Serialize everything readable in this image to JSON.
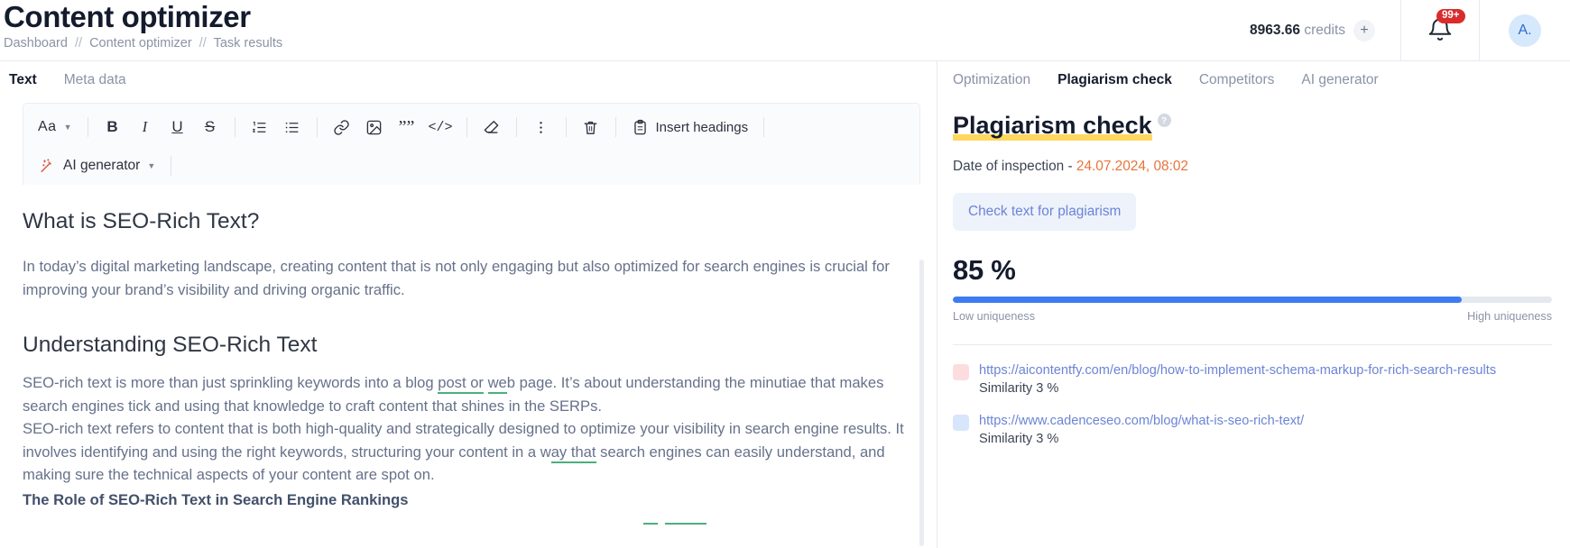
{
  "header": {
    "title": "Content optimizer",
    "breadcrumb": [
      "Dashboard",
      "Content optimizer",
      "Task results"
    ],
    "separator": "//",
    "credits_value": "8963.66",
    "credits_label": "credits",
    "add_credits_icon": "plus-icon",
    "notifications_badge": "99+",
    "avatar_initials": "A."
  },
  "editor": {
    "tabs": [
      {
        "label": "Text",
        "active": true
      },
      {
        "label": "Meta data",
        "active": false
      }
    ],
    "toolbar": {
      "font_size_label": "Aa",
      "bold_label": "B",
      "italic_label": "I",
      "underline_label": "U",
      "strike_label": "S",
      "ordered_list_icon": "ordered-list-icon",
      "bullet_list_icon": "bullet-list-icon",
      "link_icon": "link-icon",
      "image_icon": "image-icon",
      "quote_label": "””",
      "code_label": "</>",
      "eraser_icon": "eraser-icon",
      "more_icon": "more-vertical-icon",
      "trash_icon": "trash-icon",
      "insert_headings_label": "Insert headings",
      "clipboard_icon": "clipboard-icon",
      "ai_generator_label": "AI generator",
      "ai_icon": "magic-wand-icon"
    },
    "content": {
      "h2_first": "What is SEO-Rich Text?",
      "p1": "In today’s digital marketing landscape, creating content that is not only engaging but also optimized for search engines is crucial for improving your brand’s visibility and driving organic traffic.",
      "h2_second": "Understanding SEO-Rich Text",
      "p2_a": "SEO-rich text is more than just sprinkling keywords into a blog ",
      "p2_mark1": "post or",
      "p2_b": " ",
      "p2_mark2": "we",
      "p2_c": "b page. It’s about understanding the minutiae that makes search engines tick and using that knowledge to craft content that shines in the SERPs.",
      "p3_a": "SEO-rich text refers to content that is both high-quality and strategically designed to optimize your visibility in search engine results. It involves identifying and using the right keywords, structuring your content in a w",
      "p3_mark": "ay that",
      "p3_b": " search engines can easily understand, and making sure the technical aspects of your content are spot on.",
      "h3": "The Role of SEO-Rich Text in Search Engine Rankings"
    }
  },
  "right_panel": {
    "tabs": [
      {
        "label": "Optimization",
        "active": false
      },
      {
        "label": "Plagiarism check",
        "active": true
      },
      {
        "label": "Competitors",
        "active": false
      },
      {
        "label": "AI generator",
        "active": false
      }
    ],
    "title": "Plagiarism check",
    "help_icon_label": "?",
    "inspection_label": "Date of inspection - ",
    "inspection_date": "24.07.2024, 08:02",
    "check_button_label": "Check text for plagiarism",
    "score": "85 %",
    "score_percent": 85,
    "bar_low_label": "Low uniqueness",
    "bar_high_label": "High uniqueness",
    "results": [
      {
        "swatch_color": "#fbdde0",
        "url": "https://aicontentfy.com/en/blog/how-to-implement-schema-markup-for-rich-search-results",
        "similarity": "Similarity 3 %"
      },
      {
        "swatch_color": "#d8e6fb",
        "url": "https://www.cadenceseo.com/blog/what-is-seo-rich-text/",
        "similarity": "Similarity 3 %"
      }
    ]
  },
  "colors": {
    "accent_blue": "#3d7bf0",
    "link_blue": "#6b84d6",
    "highlight_yellow": "#ffd75e",
    "date_orange": "#e8743b",
    "badge_red": "#d92c2c",
    "grammar_green": "#4caf7d"
  }
}
